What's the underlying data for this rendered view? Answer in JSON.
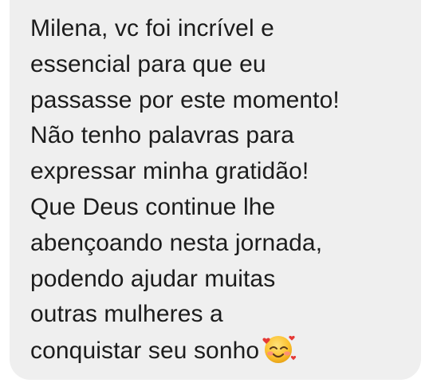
{
  "message": {
    "lines": [
      "Milena,  vc foi incrível e",
      "essencial para que eu",
      "passasse por este momento!",
      "Não tenho palavras para",
      "expressar minha gratidão!",
      "Que Deus continue lhe",
      "abençoando nesta jornada,",
      "podendo ajudar muitas",
      "outras mulheres a",
      "conquistar seu sonho"
    ],
    "emoji": "smiling-face-with-hearts-icon"
  },
  "colors": {
    "bubble_background": "#efefef",
    "text": "#1c1c1c",
    "page_background": "#ffffff"
  }
}
